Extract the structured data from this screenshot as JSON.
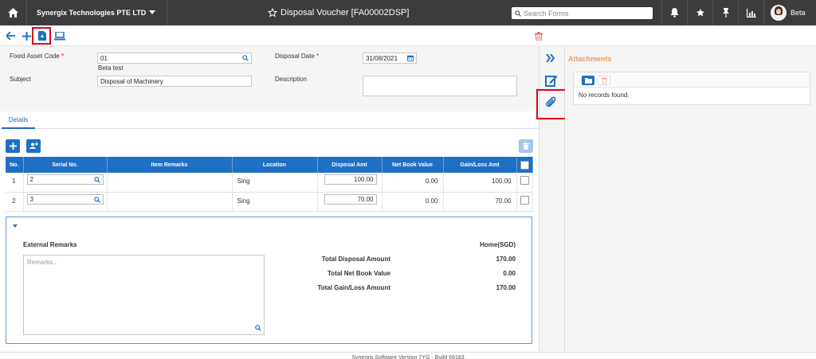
{
  "topbar": {
    "company": "Synergix Technologies PTE LTD",
    "title": "Disposal Voucher [FA00002DSP]",
    "search_placeholder": "Search Forms",
    "user": "Beta"
  },
  "form": {
    "fixed_asset_code_label": "Fixed Asset Code",
    "required_mark": "*",
    "fixed_asset_code": "01",
    "fixed_asset_desc": "Beta test",
    "disposal_date_label": "Disposal Date",
    "disposal_date": "31/08/2021",
    "subject_label": "Subject",
    "subject": "Disposal of Machinery",
    "description_label": "Description",
    "description": ""
  },
  "tabs": {
    "details": "Details"
  },
  "grid": {
    "headers": [
      "No.",
      "Serial No.",
      "Item Remarks",
      "Location",
      "Disposal Amt",
      "Net Book Value",
      "Gain/Loss Amt"
    ],
    "rows": [
      {
        "no": "1",
        "serial": "2",
        "remarks": "",
        "location": "Sing",
        "disposal": "100.00",
        "nbv": "0.00",
        "gain": "100.00"
      },
      {
        "no": "2",
        "serial": "3",
        "remarks": "",
        "location": "Sing",
        "disposal": "70.00",
        "nbv": "0.00",
        "gain": "70.00"
      }
    ]
  },
  "summary": {
    "external_remarks_label": "External Remarks",
    "remarks_placeholder": "Remarks...",
    "currency_label": "Home(SGD)",
    "total_disposal_label": "Total Disposal Amount",
    "total_disposal": "170.00",
    "total_nbv_label": "Total Net Book Value",
    "total_nbv": "0.00",
    "total_gain_label": "Total Gain/Loss Amount",
    "total_gain": "170.00"
  },
  "attachments": {
    "title": "Attachments",
    "empty": "No records found."
  },
  "footer": "Synergix Software Version 7YG - Build 69183",
  "colors": {
    "primary": "#1f6fc5",
    "topbar": "#3c3c3c",
    "highlight": "#e3001b",
    "accent": "#f39c5b"
  }
}
